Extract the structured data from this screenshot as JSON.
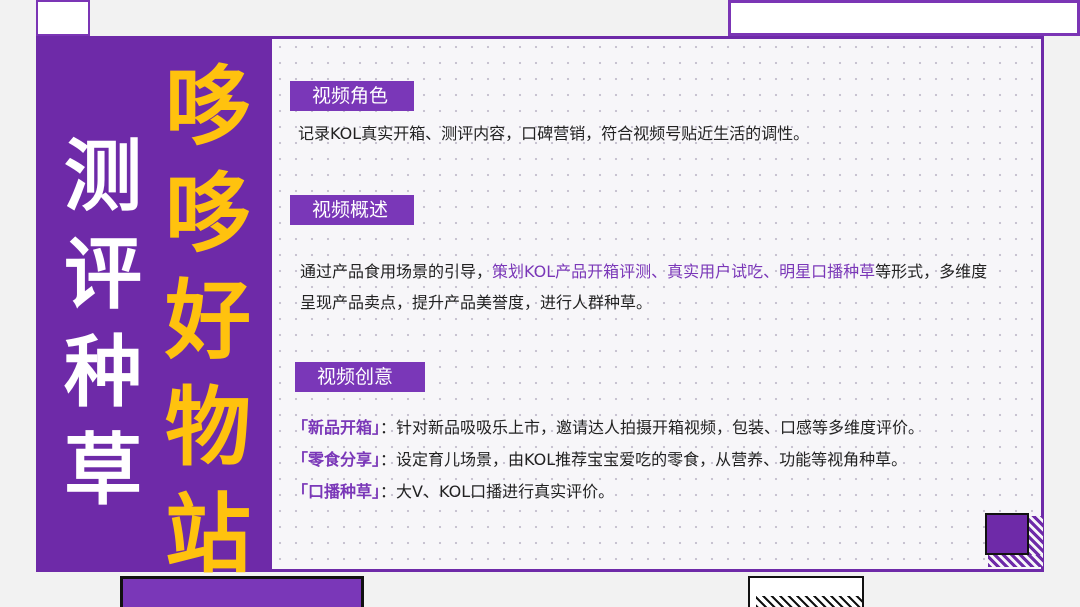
{
  "colors": {
    "purple": "#6e2aa8",
    "tag_purple": "#7a37b8",
    "yellow": "#ffc20e",
    "text": "#222222"
  },
  "title": {
    "vertical_white": "测评种草",
    "vertical_yellow": "哆哆好物站"
  },
  "sections": {
    "role": {
      "label": "视频角色",
      "text": "记录KOL真实开箱、测评内容，口碑营销，符合视频号贴近生活的调性。"
    },
    "overview": {
      "label": "视频概述",
      "text_before": "通过产品食用场景的引导，",
      "text_highlight": "策划KOL产品开箱评测、真实用户试吃、明星口播种草",
      "text_after": "等形式，多维度呈现产品卖点，提升产品美誉度，进行人群种草。"
    },
    "ideas": {
      "label": "视频创意",
      "items": [
        {
          "key": "「新品开箱」",
          "sep": "：",
          "desc": "针对新品吸吸乐上市，邀请达人拍摄开箱视频，包装、口感等多维度评价。"
        },
        {
          "key": "「零食分享」",
          "sep": "：",
          "desc": "设定育儿场景，由KOL推荐宝宝爱吃的零食，从营养、功能等视角种草。"
        },
        {
          "key": "「口播种草」",
          "sep": "：",
          "desc": "大V、KOL口播进行真实评价。"
        }
      ]
    }
  }
}
